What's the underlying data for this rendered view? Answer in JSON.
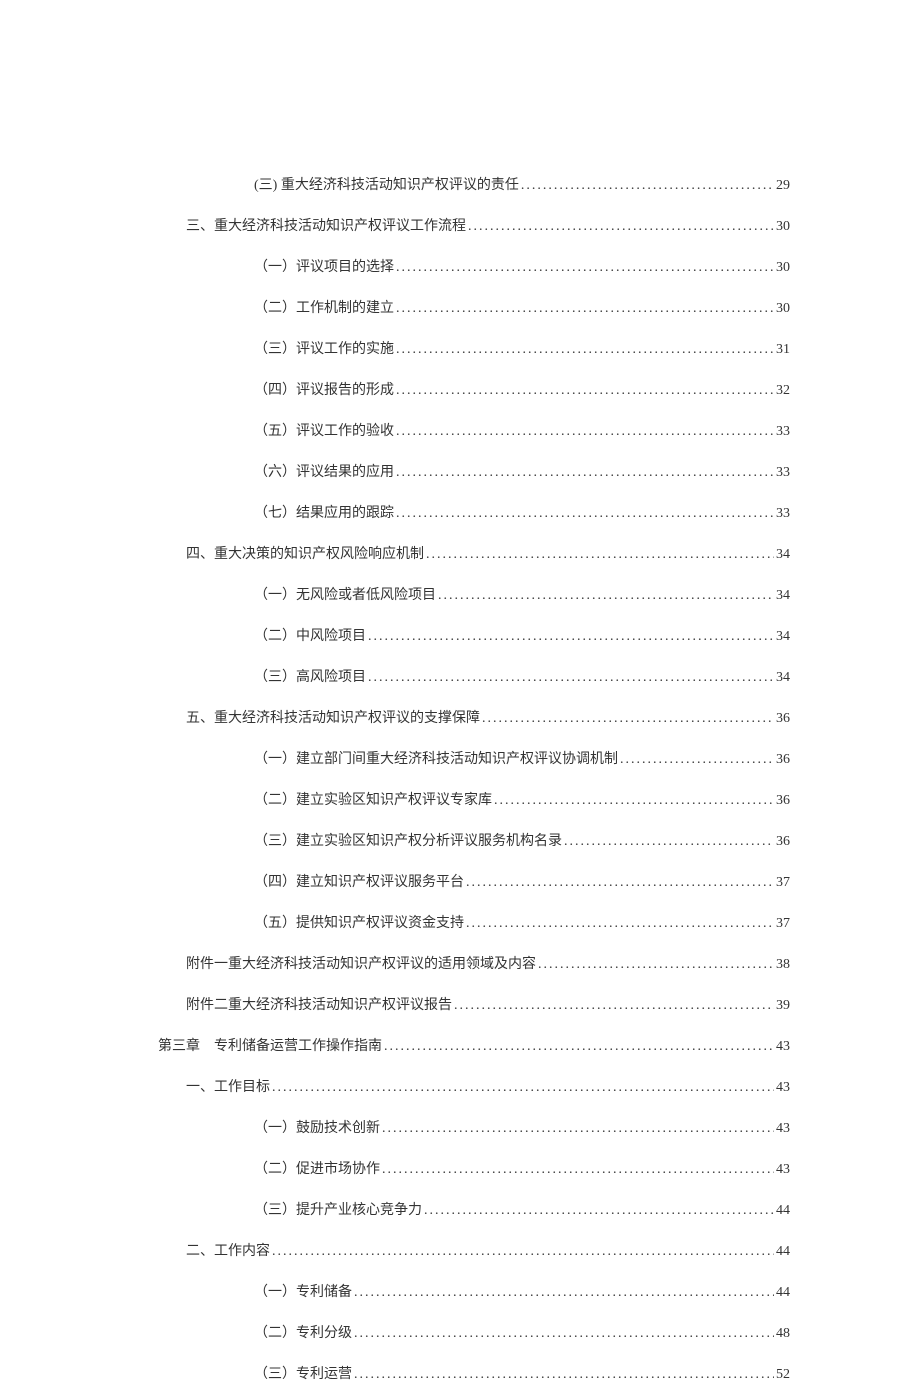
{
  "toc": [
    {
      "indent": 2,
      "label": "(三) 重大经济科技活动知识产权评议的责任",
      "page": "29"
    },
    {
      "indent": 1,
      "label": "三、重大经济科技活动知识产权评议工作流程",
      "page": "30"
    },
    {
      "indent": 2,
      "label": "（一）评议项目的选择",
      "page": "30"
    },
    {
      "indent": 2,
      "label": "（二）工作机制的建立",
      "page": "30"
    },
    {
      "indent": 2,
      "label": "（三）评议工作的实施",
      "page": "31"
    },
    {
      "indent": 2,
      "label": "（四）评议报告的形成",
      "page": "32"
    },
    {
      "indent": 2,
      "label": "（五）评议工作的验收",
      "page": "33"
    },
    {
      "indent": 2,
      "label": "（六）评议结果的应用",
      "page": "33"
    },
    {
      "indent": 2,
      "label": "（七）结果应用的跟踪",
      "page": "33"
    },
    {
      "indent": 1,
      "label": "四、重大决策的知识产权风险响应机制",
      "page": "34"
    },
    {
      "indent": 2,
      "label": "（一）无风险或者低风险项目",
      "page": "34"
    },
    {
      "indent": 2,
      "label": "（二）中风险项目",
      "page": "34"
    },
    {
      "indent": 2,
      "label": "（三）高风险项目",
      "page": "34"
    },
    {
      "indent": 1,
      "label": "五、重大经济科技活动知识产权评议的支撑保障",
      "page": "36"
    },
    {
      "indent": 2,
      "label": "（一）建立部门间重大经济科技活动知识产权评议协调机制",
      "page": "36"
    },
    {
      "indent": 2,
      "label": "（二）建立实验区知识产权评议专家库",
      "page": "36"
    },
    {
      "indent": 2,
      "label": "（三）建立实验区知识产权分析评议服务机构名录",
      "page": "36"
    },
    {
      "indent": 2,
      "label": "（四）建立知识产权评议服务平台",
      "page": "37"
    },
    {
      "indent": 2,
      "label": "（五）提供知识产权评议资金支持",
      "page": "37"
    },
    {
      "indent": 1,
      "label": "附件一重大经济科技活动知识产权评议的适用领域及内容",
      "page": "38"
    },
    {
      "indent": 1,
      "label": "附件二重大经济科技活动知识产权评议报告",
      "page": "39"
    },
    {
      "indent": 0,
      "label": "第三章　专利储备运营工作操作指南",
      "page": "43"
    },
    {
      "indent": 1,
      "label": "一、工作目标",
      "page": "43"
    },
    {
      "indent": 2,
      "label": "（一）鼓励技术创新",
      "page": "43"
    },
    {
      "indent": 2,
      "label": "（二）促进市场协作",
      "page": "43"
    },
    {
      "indent": 2,
      "label": "（三）提升产业核心竞争力",
      "page": "44"
    },
    {
      "indent": 1,
      "label": "二、工作内容",
      "page": "44"
    },
    {
      "indent": 2,
      "label": "（一）专利储备",
      "page": "44"
    },
    {
      "indent": 2,
      "label": "（二）专利分级",
      "page": "48"
    },
    {
      "indent": 2,
      "label": "（三）专利运营",
      "page": "52"
    }
  ]
}
